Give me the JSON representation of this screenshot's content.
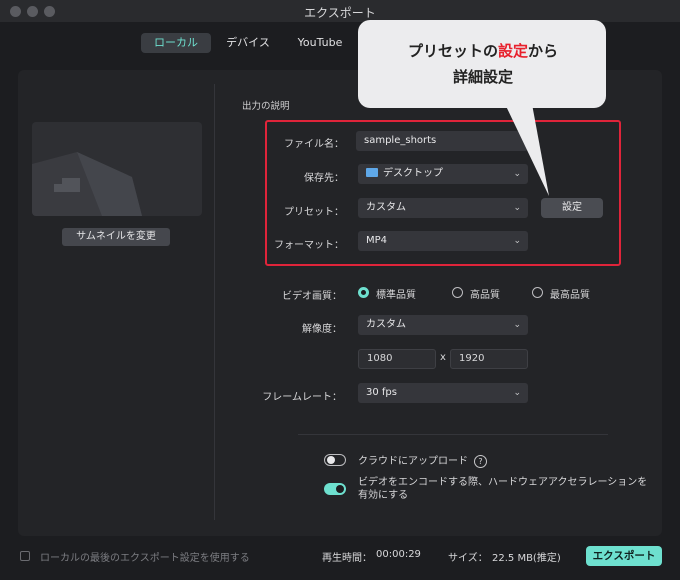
{
  "window": {
    "title": "エクスポート"
  },
  "tabs": [
    {
      "label": "ローカル",
      "active": true
    },
    {
      "label": "デバイス",
      "active": false
    },
    {
      "label": "YouTube",
      "active": false
    }
  ],
  "thumbnail": {
    "change_button": "サムネイルを変更"
  },
  "output": {
    "section_title": "出力の説明",
    "filename_label": "ファイル名：",
    "filename_value": "sample_shorts",
    "save_label": "保存先：",
    "save_value": "デスクトップ",
    "preset_label": "プリセット：",
    "preset_value": "カスタム",
    "preset_settings_button": "設定",
    "format_label": "フォーマット：",
    "format_value": "MP4"
  },
  "quality": {
    "label": "ビデオ画質：",
    "options": [
      "標準品質",
      "高品質",
      "最高品質"
    ],
    "selected": "標準品質"
  },
  "resolution": {
    "label": "解像度：",
    "value": "カスタム",
    "width": "1080",
    "separator": "x",
    "height": "1920"
  },
  "framerate": {
    "label": "フレームレート：",
    "value": "30 fps"
  },
  "toggles": {
    "cloud_upload": {
      "label": "クラウドにアップロード",
      "on": false
    },
    "hw_accel": {
      "label": "ビデオをエンコードする際、ハードウェアアクセラレーションを有効にする",
      "on": true
    }
  },
  "callout": {
    "line1_pre": "プリセットの",
    "line1_highlight": "設定",
    "line1_post": "から",
    "line2": "詳細設定"
  },
  "footer": {
    "use_last_settings": "ローカルの最後のエクスポート設定を使用する",
    "duration_label": "再生時間：",
    "duration_value": "00:00:29",
    "size_label": "サイズ：",
    "size_value": "22.5 MB(推定)",
    "export_button": "エクスポート"
  },
  "colors": {
    "accent": "#6ee0cf",
    "highlight_red": "#e0243a",
    "callout_red": "#e8202c"
  }
}
